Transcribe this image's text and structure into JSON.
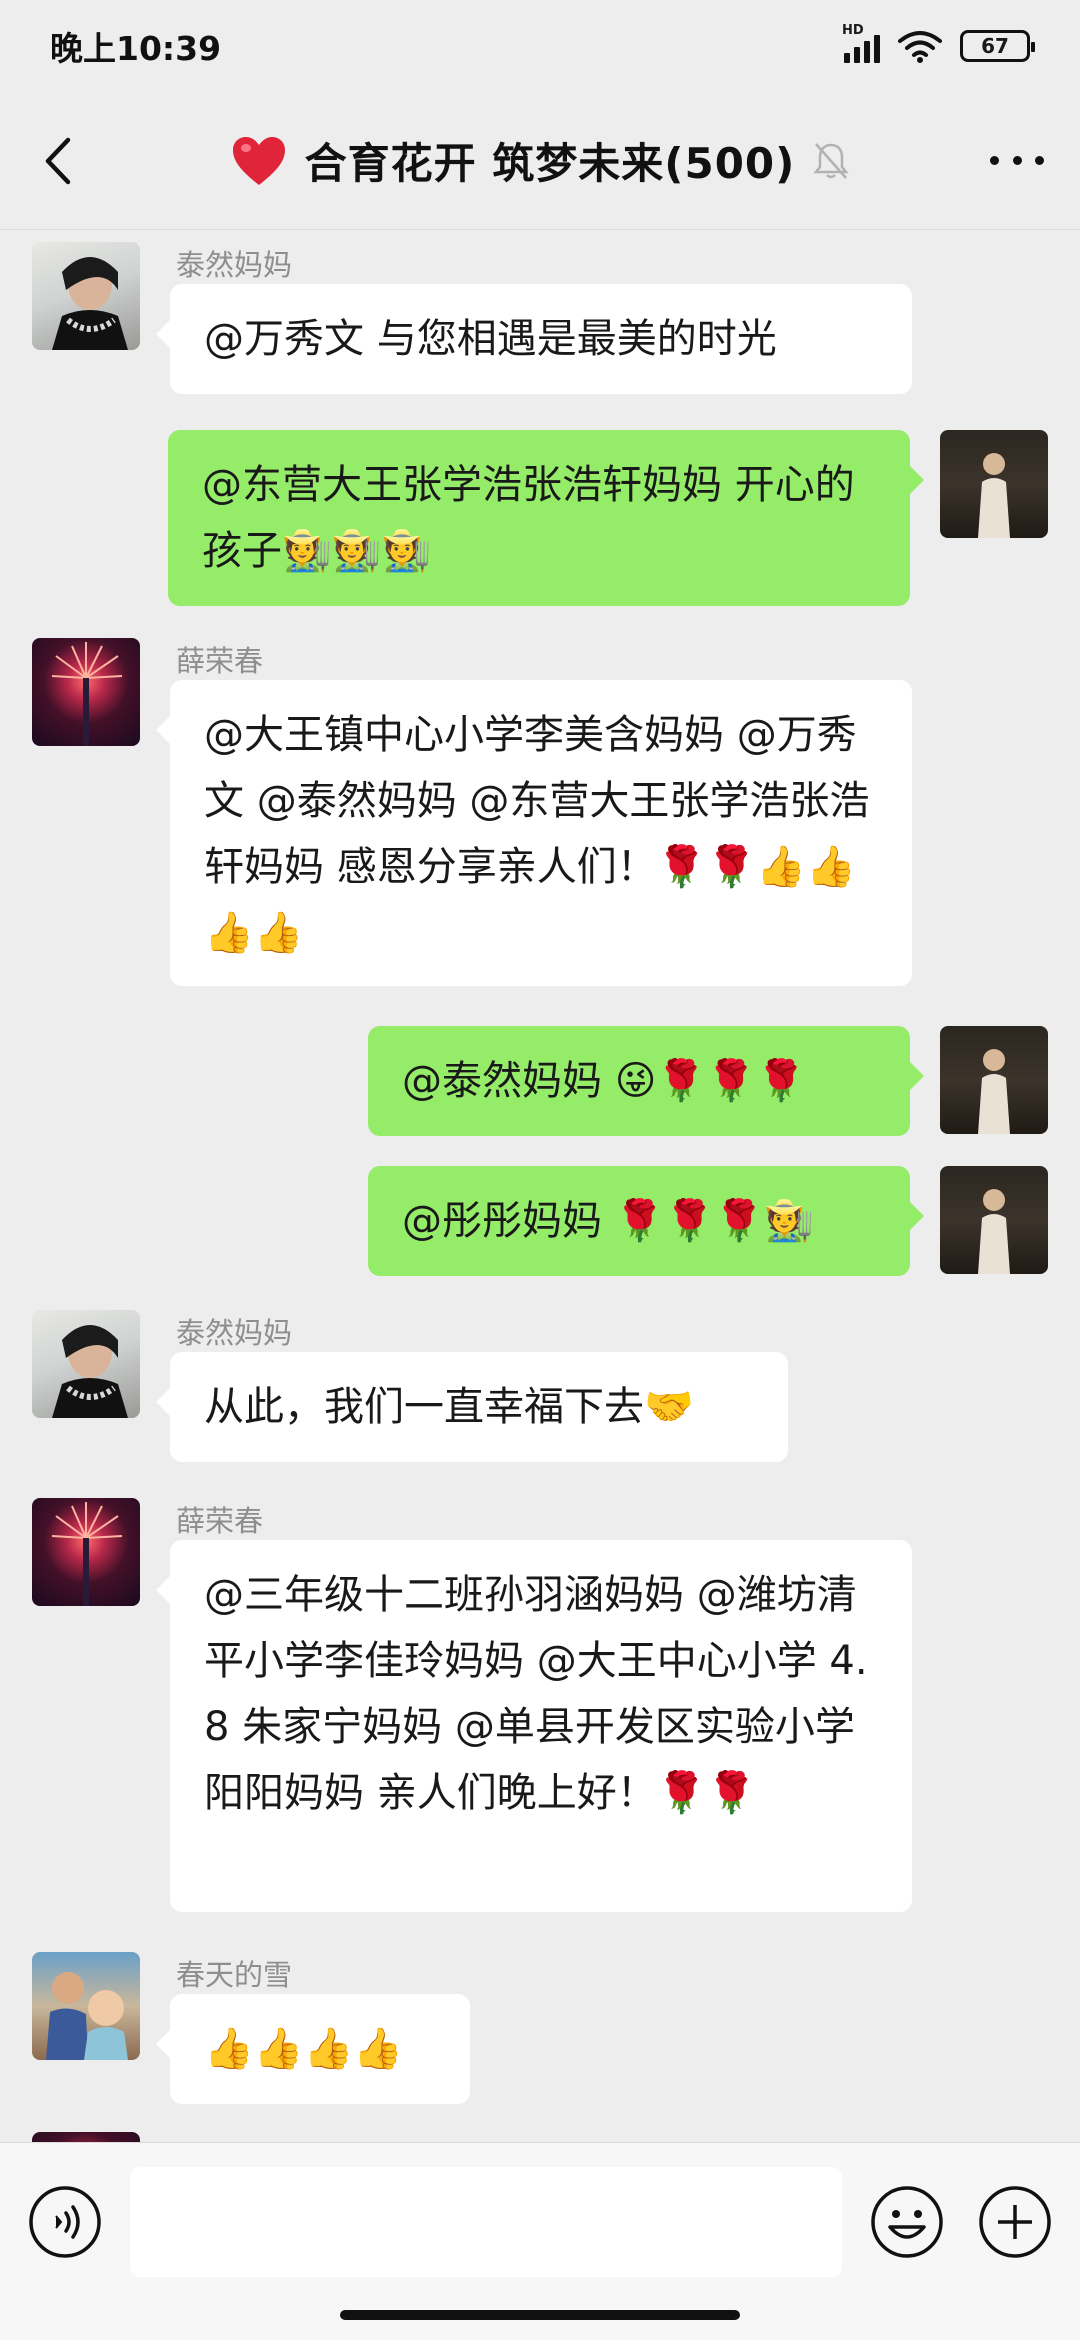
{
  "status_bar": {
    "time": "晚上10:39",
    "battery": "67",
    "network": "HD"
  },
  "header": {
    "title": "合育花开 筑梦未来(500)"
  },
  "messages": [
    {
      "sender": "泰然妈妈",
      "text": "@万秀文  与您相遇是最美的时光"
    },
    {
      "text": "@东营大王张学浩张浩轩妈妈  开心的孩子🧑‍🌾🧑‍🌾🧑‍🌾"
    },
    {
      "sender": "薛荣春",
      "text": " @大王镇中心小学李美含妈妈  @万秀文  @泰然妈妈  @东营大王张学浩张浩轩妈妈  感恩分享亲人们！🌹🌹👍👍👍👍"
    },
    {
      "text": "@泰然妈妈  😜🌹🌹🌹"
    },
    {
      "text": "@彤彤妈妈  🌹🌹🌹🧑‍🌾"
    },
    {
      "sender": "泰然妈妈",
      "text": "从此，我们一直幸福下去🤝"
    },
    {
      "sender": "薛荣春",
      "text": "@三年级十二班孙羽涵妈妈  @潍坊清平小学李佳玲妈妈  @大王中心小学 4.8 朱家宁妈妈  @单县开发区实验小学阳阳妈妈  亲人们晚上好！🌹🌹"
    },
    {
      "sender": "春天的雪",
      "text": "👍👍👍👍"
    }
  ],
  "colors": {
    "outgoing_bubble": "#95ec69",
    "incoming_bubble": "#ffffff",
    "background": "#ededed"
  },
  "icons": [
    "back-icon",
    "heart-icon",
    "mute-icon",
    "more-icon",
    "voice-icon",
    "emoji-icon",
    "plus-icon"
  ]
}
